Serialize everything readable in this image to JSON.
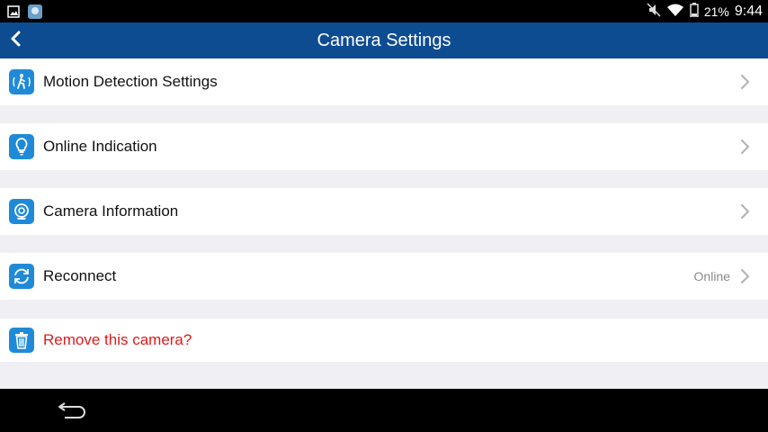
{
  "status_bar": {
    "battery": "21%",
    "time": "9:44",
    "icons": [
      "gallery-icon",
      "app-icon",
      "mute-icon",
      "wifi-icon",
      "battery-icon"
    ]
  },
  "app_bar": {
    "title": "Camera Settings",
    "back_icon": "chevron-left-icon"
  },
  "settings": [
    {
      "label": "Motion Detection Settings",
      "icon": "motion-detection-icon"
    },
    {
      "label": "Online Indication",
      "icon": "lightbulb-icon"
    },
    {
      "label": "Camera Information",
      "icon": "camera-info-icon"
    },
    {
      "label": "Reconnect",
      "icon": "reconnect-icon",
      "status": "Online"
    },
    {
      "label": "Remove this camera?",
      "icon": "trash-icon"
    }
  ],
  "colors": {
    "app_bar": "#0e4c92",
    "icon_bg": "#1f8ad8",
    "danger": "#e11a1a",
    "background": "#efeff4"
  }
}
